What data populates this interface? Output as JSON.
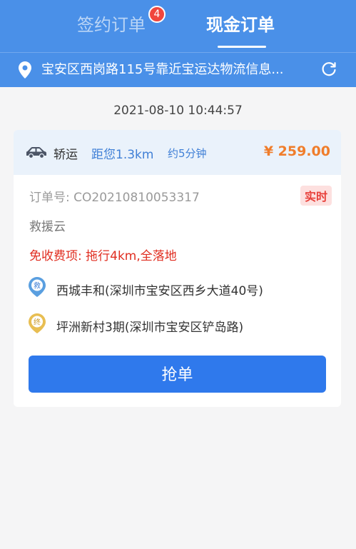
{
  "tabs": [
    {
      "label": "签约订单",
      "badge": "4",
      "active": false
    },
    {
      "label": "现金订单",
      "active": true
    }
  ],
  "location": {
    "text": "宝安区西岗路115号靠近宝运达物流信息..."
  },
  "timestamp": "2021-08-10 10:44:57",
  "order": {
    "service": "轿运",
    "distance": "距您1.3km",
    "eta": "约5分钟",
    "price": "¥ 259.00",
    "order_no": "订单号: CO20210810053317",
    "tag": "实时",
    "company": "救援云",
    "fee": "免收费项: 拖行4km,全落地",
    "from_badge": "救",
    "from": "西城丰和(深圳市宝安区西乡大道40号)",
    "to_badge": "终",
    "to": "坪洲新村3期(深圳市宝安区铲岛路)",
    "button": "抢单"
  },
  "colors": {
    "header": "#4a90e8",
    "price": "#f07d2b",
    "fee": "#e02d20",
    "button": "#2f79ec"
  }
}
